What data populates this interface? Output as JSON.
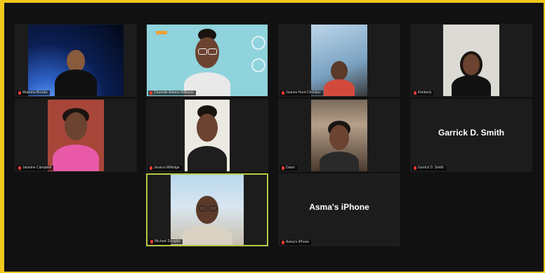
{
  "participants": [
    {
      "name": "Makisha Brooks",
      "muted": true
    },
    {
      "name": "Chanelle Adams-Williams",
      "muted": true
    },
    {
      "name": "Jeanne Hunt-Christian",
      "muted": true
    },
    {
      "name": "Kimberly",
      "muted": true
    },
    {
      "name": "Jasmine Campbell",
      "muted": true
    },
    {
      "name": "Jessica Milledge",
      "muted": true
    },
    {
      "name": "Dawn",
      "muted": true
    },
    {
      "name": "Garrick D. Smith",
      "muted": true,
      "video_off": true,
      "display_name": "Garrick D. Smith"
    },
    {
      "name": "Michael Douglas",
      "muted": true,
      "active_speaker": true
    },
    {
      "name": "Asma's iPhone",
      "muted": true,
      "video_off": true,
      "display_name": "Asma's iPhone"
    }
  ],
  "theme": {
    "background": "#111111",
    "tile": "#1c1c1c",
    "active_border": "#b7c944",
    "outer_border": "#f2c81d",
    "mute_color": "#e03a2f"
  }
}
